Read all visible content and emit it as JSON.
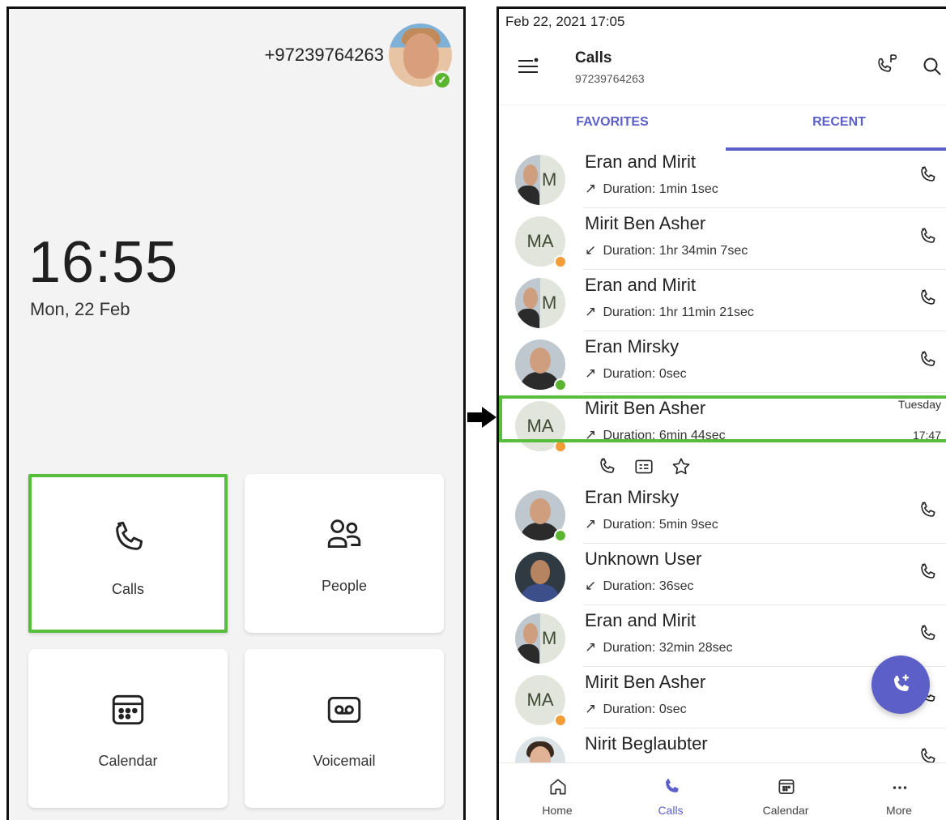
{
  "home_screen": {
    "phone_number": "+97239764263",
    "clock": "16:55",
    "date": "Mon, 22 Feb",
    "tiles": [
      {
        "label": "Calls",
        "icon": "phone-icon"
      },
      {
        "label": "People",
        "icon": "people-icon"
      },
      {
        "label": "Calendar",
        "icon": "calendar-icon"
      },
      {
        "label": "Voicemail",
        "icon": "voicemail-icon"
      }
    ],
    "selected_tile": "Calls",
    "highlight_color": "#58bc3c",
    "presence_color": "#5cb531"
  },
  "calls_screen": {
    "status_bar": "Feb 22, 2021  17:05",
    "header": {
      "title": "Calls",
      "subtitle": "97239764263"
    },
    "tabs": [
      {
        "label": "FAVORITES",
        "active": false
      },
      {
        "label": "RECENT",
        "active": true
      }
    ],
    "accent_color": "#5b5fc7",
    "calls": [
      {
        "name": "Eran and Mirit",
        "direction": "↗",
        "detail": "Duration: 1min 1sec",
        "avatar": "split",
        "initials": "M"
      },
      {
        "name": "Mirit Ben Asher",
        "direction": "↙",
        "detail": "Duration: 1hr 34min 7sec",
        "avatar": "initials",
        "initials": "MA",
        "presence": "away"
      },
      {
        "name": "Eran and Mirit",
        "direction": "↗",
        "detail": "Duration: 1hr 11min 21sec",
        "avatar": "split",
        "initials": "M"
      },
      {
        "name": "Eran Mirsky",
        "direction": "↗",
        "detail": "Duration: 0sec",
        "avatar": "photo",
        "presence": "available"
      },
      {
        "name": "Mirit Ben Asher",
        "direction": "↗",
        "detail": "Duration: 6min 44sec",
        "avatar": "initials",
        "initials": "MA",
        "presence": "away",
        "day": "Tuesday",
        "time": "17:47",
        "selected": true
      },
      {
        "name": "Eran Mirsky",
        "direction": "↗",
        "detail": "Duration: 5min 9sec",
        "avatar": "photo",
        "presence": "available"
      },
      {
        "name": "Unknown User",
        "direction": "↙",
        "detail": "Duration: 36sec",
        "avatar": "photo"
      },
      {
        "name": "Eran and Mirit",
        "direction": "↗",
        "detail": "Duration: 32min 28sec",
        "avatar": "split",
        "initials": "M"
      },
      {
        "name": "Mirit Ben Asher",
        "direction": "↗",
        "detail": "Duration: 0sec",
        "avatar": "initials",
        "initials": "MA",
        "presence": "away"
      },
      {
        "name": "Nirit Beglaubter",
        "direction": "",
        "detail": "",
        "avatar": "photo"
      }
    ],
    "row_actions": [
      "call-icon",
      "contact-card-icon",
      "star-icon"
    ],
    "bottom_nav": [
      {
        "label": "Home",
        "icon": "home-icon",
        "active": false
      },
      {
        "label": "Calls",
        "icon": "phone-icon",
        "active": true
      },
      {
        "label": "Calendar",
        "icon": "calendar-icon",
        "active": false
      },
      {
        "label": "More",
        "icon": "more-icon",
        "active": false
      }
    ]
  }
}
